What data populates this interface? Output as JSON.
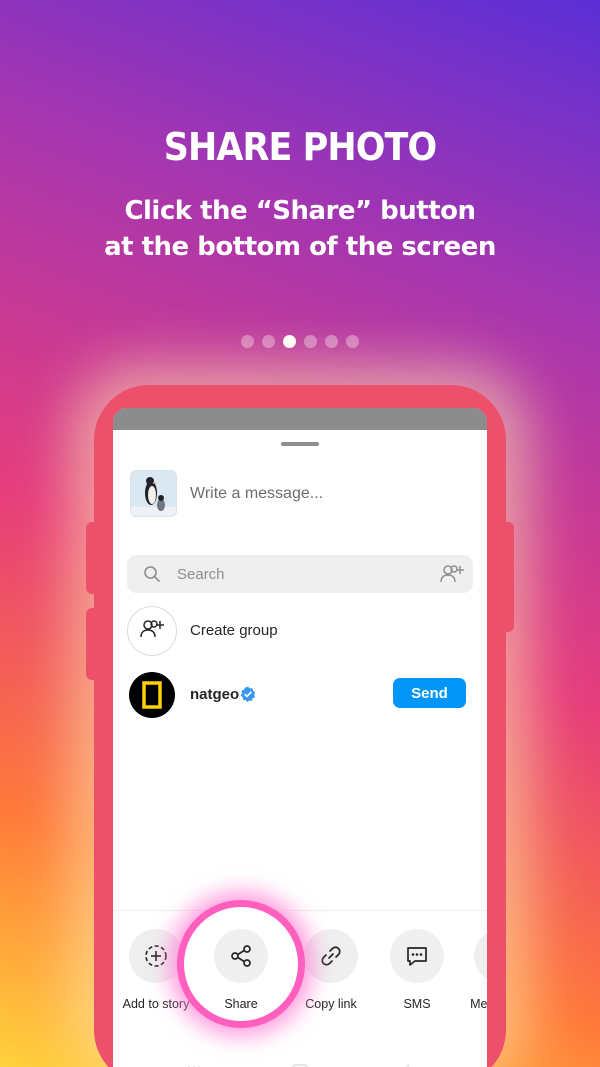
{
  "header": {
    "title": "SHARE PHOTO",
    "subtitle_line1": "Click the “Share” button",
    "subtitle_line2": "at the bottom of the screen"
  },
  "pager": {
    "total": 6,
    "active_index": 2
  },
  "sheet": {
    "message_placeholder": "Write a message...",
    "search_placeholder": "Search",
    "create_group_label": "Create group",
    "contacts": [
      {
        "name": "natgeo",
        "verified": true,
        "action": "Send"
      }
    ]
  },
  "share_options": [
    {
      "label": "Add to story",
      "icon": "add-to-story-icon"
    },
    {
      "label": "Share",
      "icon": "share-icon",
      "highlighted": true
    },
    {
      "label": "Copy link",
      "icon": "link-icon"
    },
    {
      "label": "SMS",
      "icon": "sms-icon"
    },
    {
      "label": "Messenger",
      "icon": "messenger-icon"
    }
  ],
  "colors": {
    "phone_frame": "#ed506b",
    "send_button": "#0095f6",
    "highlight_ring": "#ff5fbf",
    "verified_badge": "#3897f0"
  }
}
